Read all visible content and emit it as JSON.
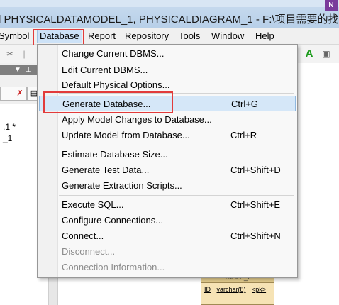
{
  "window": {
    "title": "l PHYSICALDATAMODEL_1, PHYSICALDIAGRAM_1 - F:\\项目需要的找"
  },
  "menubar": {
    "items": [
      "Symbol",
      "Database",
      "Report",
      "Repository",
      "Tools",
      "Window",
      "Help"
    ],
    "active": "Database"
  },
  "dropdown": {
    "items": [
      {
        "label": "Change Current DBMS...",
        "shortcut": ""
      },
      {
        "label": "Edit Current DBMS...",
        "shortcut": ""
      },
      {
        "label": "Default Physical Options...",
        "shortcut": ""
      },
      {
        "label": "Generate Database...",
        "shortcut": "Ctrl+G"
      },
      {
        "label": "Apply Model Changes to Database...",
        "shortcut": ""
      },
      {
        "label": "Update Model from Database...",
        "shortcut": "Ctrl+R"
      },
      {
        "label": "Estimate Database Size...",
        "shortcut": ""
      },
      {
        "label": "Generate Test Data...",
        "shortcut": "Ctrl+Shift+D"
      },
      {
        "label": "Generate Extraction Scripts...",
        "shortcut": ""
      },
      {
        "label": "Execute SQL...",
        "shortcut": "Ctrl+Shift+E"
      },
      {
        "label": "Configure Connections...",
        "shortcut": ""
      },
      {
        "label": "Connect...",
        "shortcut": "Ctrl+Shift+N"
      },
      {
        "label": "Disconnect...",
        "shortcut": ""
      },
      {
        "label": "Connection Information...",
        "shortcut": ""
      }
    ]
  },
  "left_tree": {
    "line1": ".1 *",
    "line2": "_1"
  },
  "table": {
    "name": "TABLE_2",
    "column": "ID",
    "type": "varchar(8)",
    "key": "<pk>"
  },
  "colors": {
    "highlight_red": "#e23b3b",
    "selection_blue": "#d5e7f8",
    "table_fill": "#f6e3b5"
  }
}
